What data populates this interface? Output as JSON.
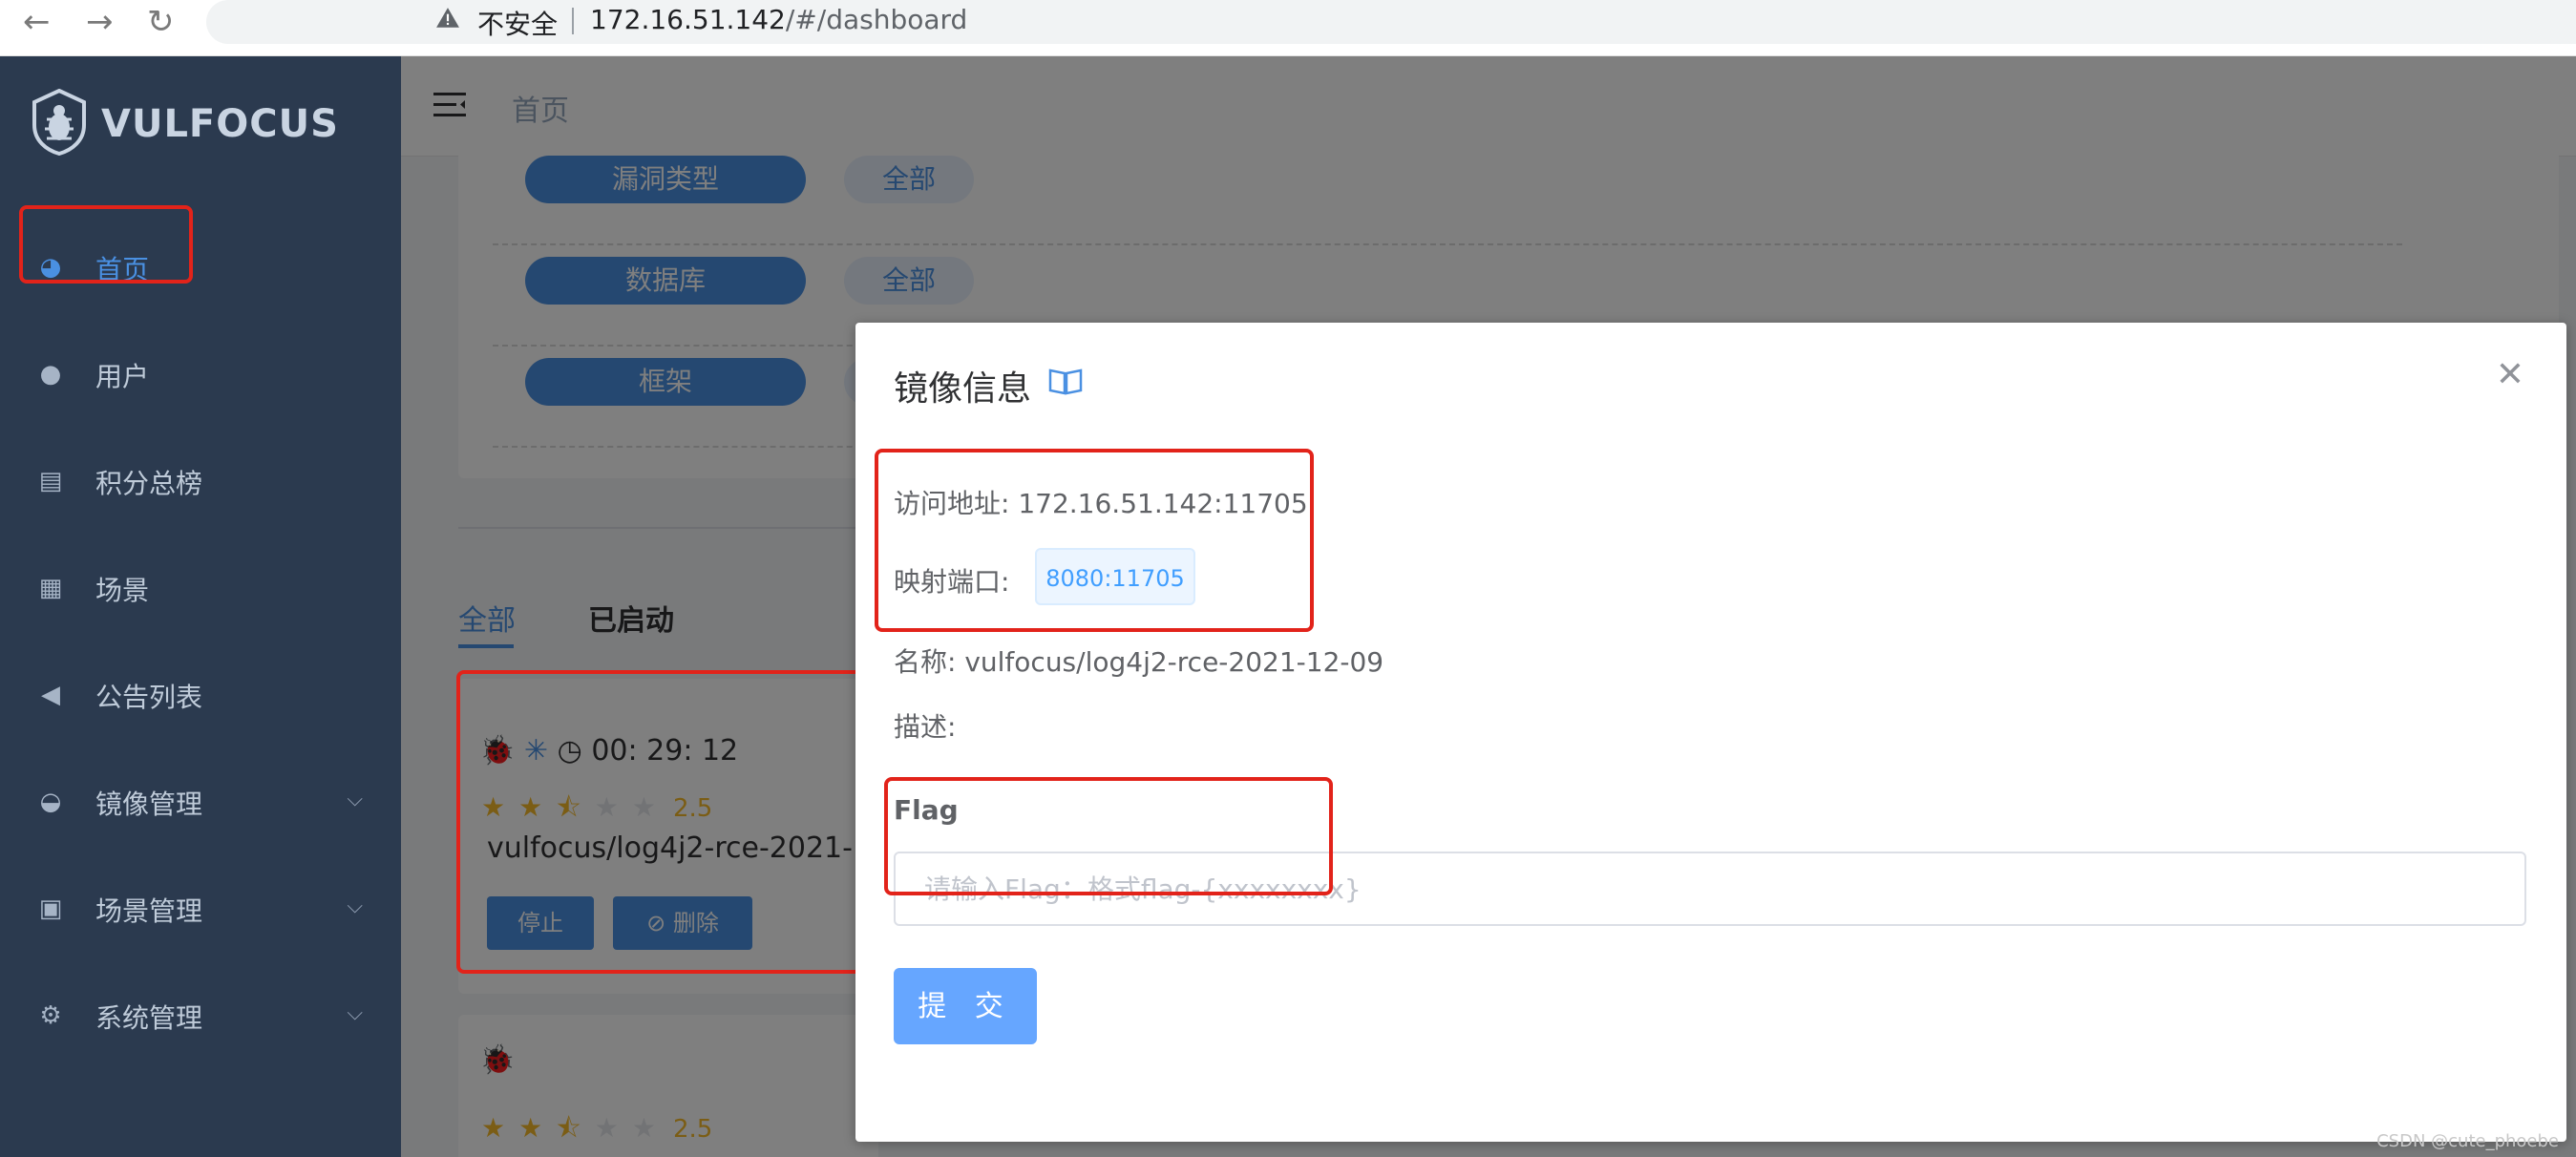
{
  "browser": {
    "insecure_label": "不安全",
    "url_host": "172.16.51.142",
    "url_path": "/#/dashboard"
  },
  "sidebar": {
    "brand": "VULFOCUS",
    "items": [
      {
        "label": "首页",
        "icon": "dashboard-icon"
      },
      {
        "label": "用户",
        "icon": "user-icon"
      },
      {
        "label": "积分总榜",
        "icon": "ranking-icon"
      },
      {
        "label": "场景",
        "icon": "grid-icon"
      },
      {
        "label": "公告列表",
        "icon": "megaphone-icon"
      },
      {
        "label": "镜像管理",
        "icon": "docker-icon"
      },
      {
        "label": "场景管理",
        "icon": "scene-icon"
      },
      {
        "label": "系统管理",
        "icon": "gear-icon"
      }
    ]
  },
  "header": {
    "breadcrumb": "首页"
  },
  "filters": [
    {
      "label": "漏洞类型",
      "value": "全部"
    },
    {
      "label": "数据库",
      "value": "全部"
    },
    {
      "label": "框架",
      "value": "全部"
    }
  ],
  "tabs": [
    {
      "label": "全部"
    },
    {
      "label": "已启动"
    }
  ],
  "cards": [
    {
      "timer": "00: 29: 12",
      "rating": "2.5",
      "name": "vulfocus/log4j2-rce-2021-12-09",
      "stop_label": "停止",
      "delete_label": "删除"
    },
    {
      "rating": "2.5"
    }
  ],
  "modal": {
    "title": "镜像信息",
    "address_label": "访问地址: 172.16.51.142:11705",
    "port_label": "映射端口:",
    "port_value": "8080:11705",
    "name_label": "名称: vulfocus/log4j2-rce-2021-12-09",
    "desc_label": "描述:",
    "flag_label": "Flag",
    "flag_placeholder": "请输入Flag：格式flag-{xxxxxxxx}",
    "submit_label": "提 交"
  },
  "colors": {
    "sidebar_bg": "#2b3a4f",
    "accent": "#4a90e2",
    "highlight_red": "#e2231a",
    "submit": "#66a6ff"
  },
  "watermark": "CSDN @cute_phoebe"
}
